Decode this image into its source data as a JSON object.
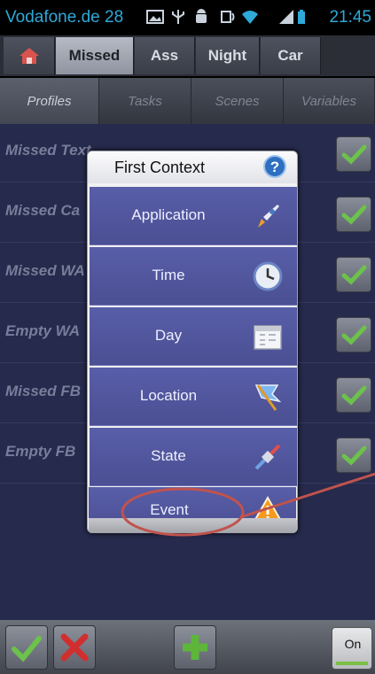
{
  "status_bar": {
    "carrier": "Vodafone.de 28",
    "time": "21:45",
    "icons": [
      "image-icon",
      "usb-icon",
      "android-debug-icon",
      "nfc-icon",
      "wifi-icon",
      "signal-icon",
      "battery-icon"
    ]
  },
  "project_tabs": {
    "home_icon": "home-icon",
    "tabs": [
      "Missed",
      "Ass",
      "Night",
      "Car"
    ],
    "active": "Missed"
  },
  "type_tabs": {
    "tabs": [
      "Profiles",
      "Tasks",
      "Scenes",
      "Variables"
    ],
    "active": "Profiles"
  },
  "profiles": [
    {
      "name": "Missed Text",
      "enabled": true
    },
    {
      "name": "Missed Ca",
      "enabled": true
    },
    {
      "name": "Missed WA",
      "enabled": true
    },
    {
      "name": "Empty WA",
      "enabled": true
    },
    {
      "name": "Missed FB",
      "enabled": true
    },
    {
      "name": "Empty FB",
      "enabled": true
    }
  ],
  "dialog": {
    "title": "First Context",
    "help_icon": "help-icon",
    "options": [
      {
        "label": "Application",
        "icon": "rocket-icon"
      },
      {
        "label": "Time",
        "icon": "clock-icon"
      },
      {
        "label": "Day",
        "icon": "calendar-icon"
      },
      {
        "label": "Location",
        "icon": "flag-icon"
      },
      {
        "label": "State",
        "icon": "plug-icon"
      },
      {
        "label": "Event",
        "icon": "warning-icon"
      }
    ],
    "highlighted": "Event"
  },
  "bottom_bar": {
    "enable_icon": "checkmark-icon",
    "delete_icon": "delete-x-icon",
    "add_icon": "add-plus-icon",
    "toggle_label": "On"
  },
  "colors": {
    "highlight": "#c0534d",
    "check": "#6cc24a",
    "dialog_option": "#5156a0"
  }
}
